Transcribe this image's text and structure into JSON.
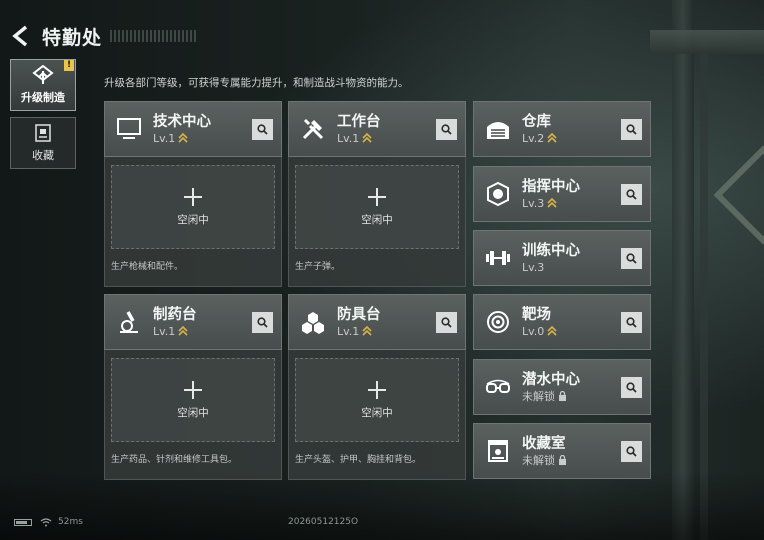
{
  "header": {
    "title": "特勤处"
  },
  "tabs": [
    {
      "label": "升级制造",
      "icon": "upgrade-icon",
      "badge": "!"
    },
    {
      "label": "收藏",
      "icon": "collection-icon"
    }
  ],
  "description": "升级各部门等级，可获得专属能力提升，和制造战斗物资的能力。",
  "production_cards": [
    {
      "name": "技术中心",
      "level": "Lv.1",
      "icon": "computer-icon",
      "idle": "空闲中",
      "desc": "生产枪械和配件。"
    },
    {
      "name": "工作台",
      "level": "Lv.1",
      "icon": "tools-icon",
      "idle": "空闲中",
      "desc": "生产子弹。"
    },
    {
      "name": "制药台",
      "level": "Lv.1",
      "icon": "microscope-icon",
      "idle": "空闲中",
      "desc": "生产药品、针剂和维修工具包。"
    },
    {
      "name": "防具台",
      "level": "Lv.1",
      "icon": "armor-plates-icon",
      "idle": "空闲中",
      "desc": "生产头盔、护甲、胸挂和背包。"
    }
  ],
  "facilities": [
    {
      "name": "仓库",
      "level": "Lv.2",
      "icon": "warehouse-icon",
      "upgradable": true
    },
    {
      "name": "指挥中心",
      "level": "Lv.3",
      "icon": "chip-icon",
      "upgradable": true
    },
    {
      "name": "训练中心",
      "level": "Lv.3",
      "icon": "dumbbell-icon",
      "upgradable": false
    },
    {
      "name": "靶场",
      "level": "Lv.0",
      "icon": "target-icon",
      "upgradable": true
    },
    {
      "name": "潜水中心",
      "level": "未解锁",
      "icon": "diving-goggles-icon",
      "locked": true
    },
    {
      "name": "收藏室",
      "level": "未解锁",
      "icon": "display-case-icon",
      "locked": true
    }
  ],
  "status_bar": {
    "ping": "52ms",
    "session_id": "20260512125O"
  },
  "colors": {
    "accent_gold": "#d9b34a",
    "card_header": "#535a58",
    "search_button": "#d9dcdb"
  }
}
